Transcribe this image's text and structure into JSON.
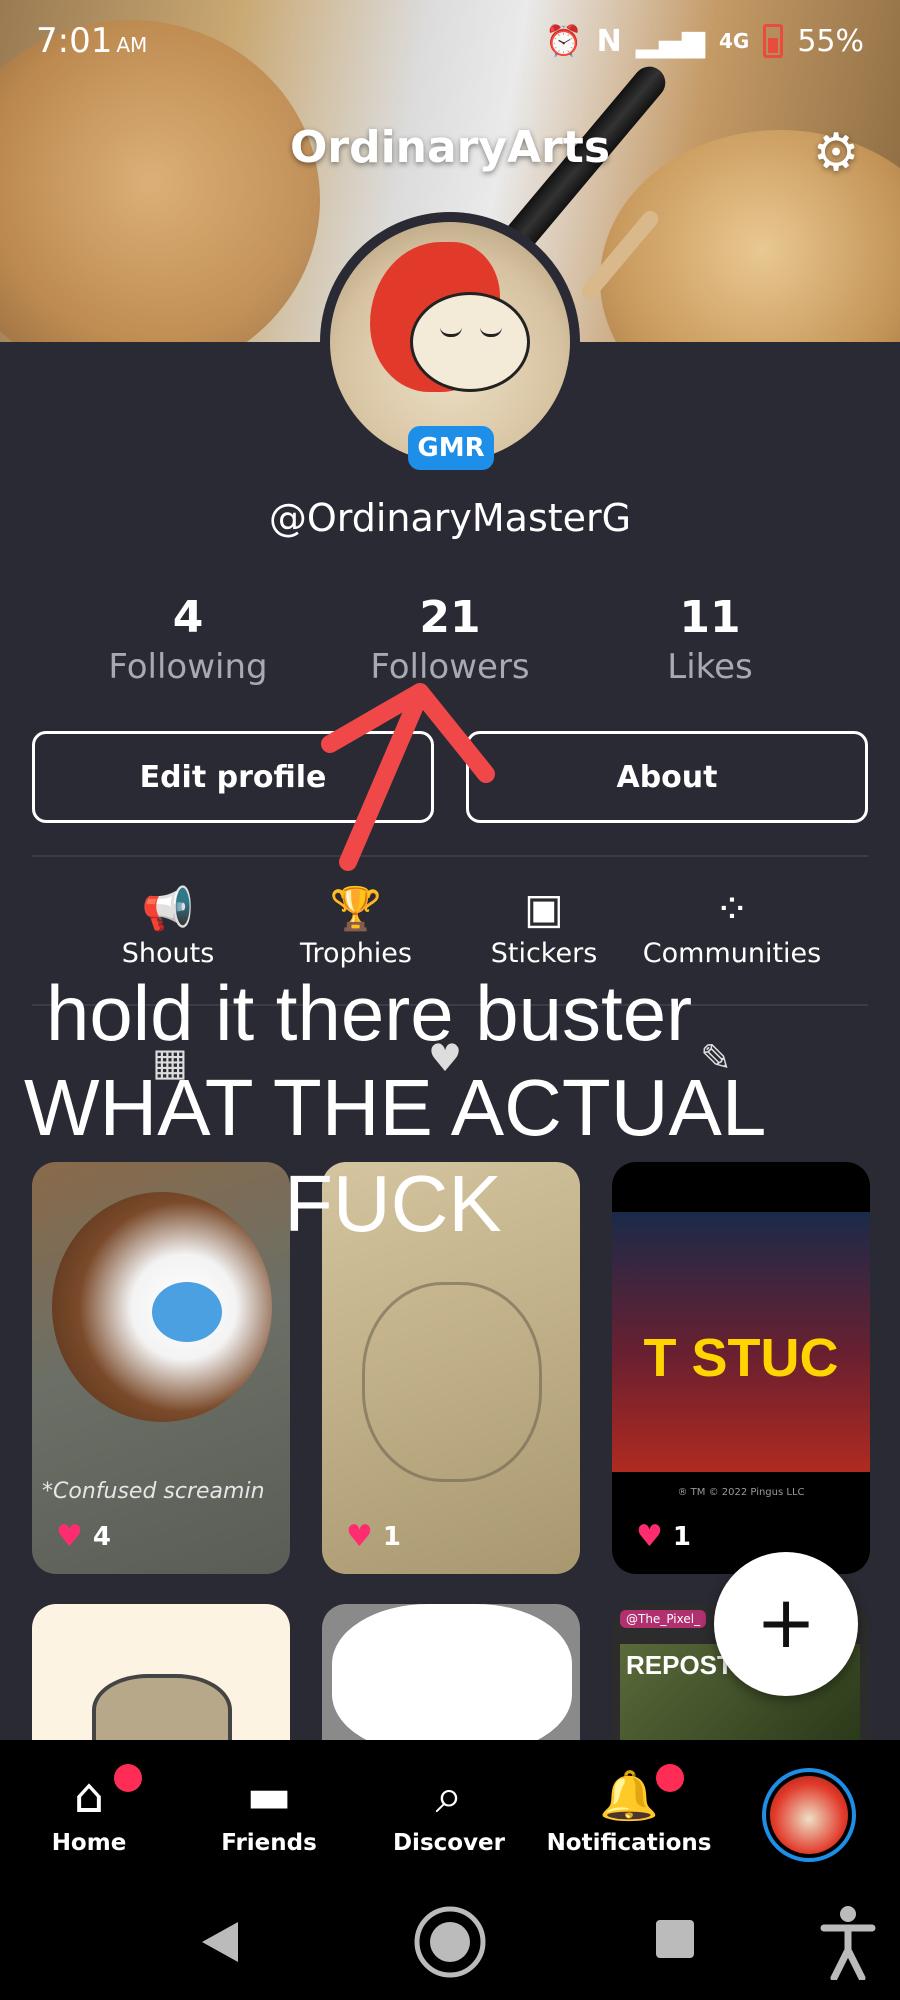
{
  "status_bar": {
    "time": "7:01",
    "ampm": "AM",
    "network": "4G",
    "battery": "55%"
  },
  "profile": {
    "title": "OrdinaryArts",
    "badge": "GMR",
    "handle": "@OrdinaryMasterG",
    "stats": [
      {
        "value": "4",
        "label": "Following"
      },
      {
        "value": "21",
        "label": "Followers"
      },
      {
        "value": "11",
        "label": "Likes"
      }
    ],
    "buttons": {
      "edit": "Edit profile",
      "about": "About"
    }
  },
  "tabs": [
    {
      "label": "Shouts",
      "icon": "megaphone-icon"
    },
    {
      "label": "Trophies",
      "icon": "trophy-icon"
    },
    {
      "label": "Stickers",
      "icon": "sticker-icon"
    },
    {
      "label": "Communities",
      "icon": "communities-icon"
    }
  ],
  "meme_text": {
    "line1": "hold it there buster",
    "line2": "WHAT THE ACTUAL",
    "line3": "FUCK"
  },
  "posts": [
    {
      "likes": "4",
      "caption": "*Confused screamin"
    },
    {
      "likes": "1"
    },
    {
      "likes": "1",
      "overlay_text": "T STUC",
      "fine_print": "® TM © 2022 Pingus LLC"
    }
  ],
  "partial_posts": [
    {
      "header": "@The_Pixel_",
      "text": "REPOST"
    }
  ],
  "bottom_nav": [
    {
      "label": "Home",
      "icon": "home-icon",
      "has_dot": true
    },
    {
      "label": "Friends",
      "icon": "chat-icon",
      "has_dot": false
    },
    {
      "label": "Discover",
      "icon": "search-icon",
      "has_dot": false
    },
    {
      "label": "Notifications",
      "icon": "bell-icon",
      "has_dot": true
    }
  ],
  "colors": {
    "background": "#2a2a34",
    "accent": "#1e8fe8",
    "like": "#ff2d6f",
    "notification_dot": "#ff2d55",
    "annotation_arrow": "#f04848"
  }
}
